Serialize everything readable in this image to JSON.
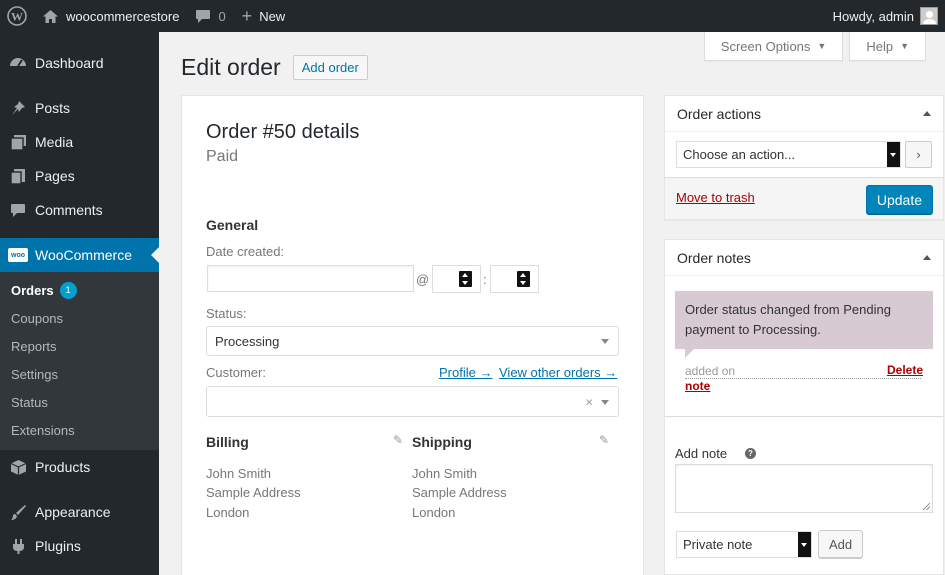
{
  "admin_bar": {
    "site_name": "woocommercestore",
    "comment_count": "0",
    "new_label": "New",
    "greeting": "Howdy, admin"
  },
  "sidebar": {
    "items": [
      {
        "label": "Dashboard",
        "icon": "dashboard-icon"
      },
      {
        "label": "Posts",
        "icon": "pin-icon"
      },
      {
        "label": "Media",
        "icon": "media-icon"
      },
      {
        "label": "Pages",
        "icon": "pages-icon"
      },
      {
        "label": "Comments",
        "icon": "comments-icon"
      },
      {
        "label": "WooCommerce",
        "icon": "woocommerce-icon"
      },
      {
        "label": "Products",
        "icon": "products-icon"
      },
      {
        "label": "Appearance",
        "icon": "appearance-icon"
      },
      {
        "label": "Plugins",
        "icon": "plugins-icon"
      }
    ],
    "woo_logo_text": "woo",
    "submenu": [
      {
        "label": "Orders",
        "badge": "1"
      },
      {
        "label": "Coupons"
      },
      {
        "label": "Reports"
      },
      {
        "label": "Settings"
      },
      {
        "label": "Status"
      },
      {
        "label": "Extensions"
      }
    ]
  },
  "screen_meta": {
    "screen_options": "Screen Options",
    "help": "Help"
  },
  "page": {
    "title": "Edit order",
    "add_order": "Add order"
  },
  "order": {
    "heading": "Order #50 details",
    "payment_status": "Paid",
    "general_title": "General",
    "date_label": "Date created:",
    "at_sep": "@",
    "time_sep": ":",
    "status_label": "Status:",
    "status_value": "Processing",
    "customer_label": "Customer:",
    "profile_link": "Profile →",
    "other_orders_link": "View other orders →",
    "clear_symbol": "×",
    "billing": {
      "title": "Billing",
      "lines": [
        "John Smith",
        "Sample Address",
        "London"
      ]
    },
    "shipping": {
      "title": "Shipping",
      "lines": [
        "John Smith",
        "Sample Address",
        "London"
      ]
    }
  },
  "order_actions": {
    "title": "Order actions",
    "select_placeholder": "Choose an action...",
    "go_symbol": "›",
    "move_to_trash": "Move to trash",
    "update": "Update"
  },
  "order_notes": {
    "title": "Order notes",
    "note_text": "Order status changed from Pending payment to Processing.",
    "added_on": "added on",
    "delete_word1": "Delete",
    "delete_word2": "note",
    "add_note_label": "Add note",
    "help_symbol": "?",
    "note_type": "Private note",
    "add_button": "Add"
  },
  "colors": {
    "admin_dark": "#23282d",
    "accent": "#0073aa",
    "primary_button": "#0085ba",
    "note_bg": "#d7cad2",
    "trash": "#a00000",
    "badge": "#00a0d2"
  }
}
